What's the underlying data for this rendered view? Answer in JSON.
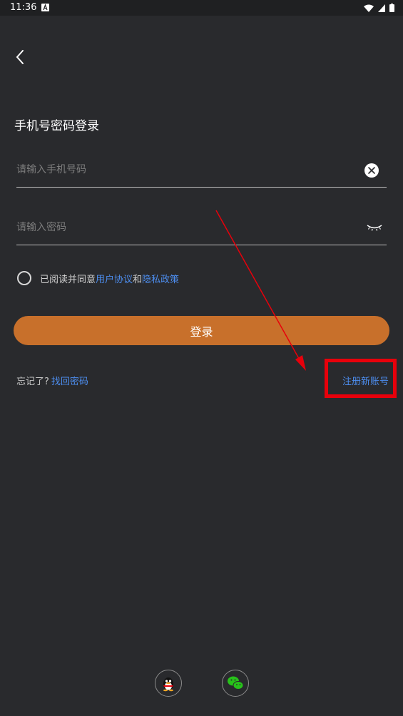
{
  "status_bar": {
    "time": "11:36"
  },
  "page": {
    "title": "手机号密码登录"
  },
  "form": {
    "phone_placeholder": "请输入手机号码",
    "password_placeholder": "请输入密码",
    "agree_prefix": "已阅读并同意",
    "user_agreement": "用户协议",
    "and": "和",
    "privacy_policy": "隐私政策",
    "login_label": "登录"
  },
  "links": {
    "forgot_prefix": "忘记了?",
    "recover_password": "找回密码",
    "register_new": "注册新账号"
  },
  "social": {
    "qq": "qq-icon",
    "wechat": "wechat-icon"
  },
  "colors": {
    "background": "#292a2d",
    "accent": "#c8702b",
    "link": "#4d8ef0",
    "highlight": "#e8000b"
  }
}
